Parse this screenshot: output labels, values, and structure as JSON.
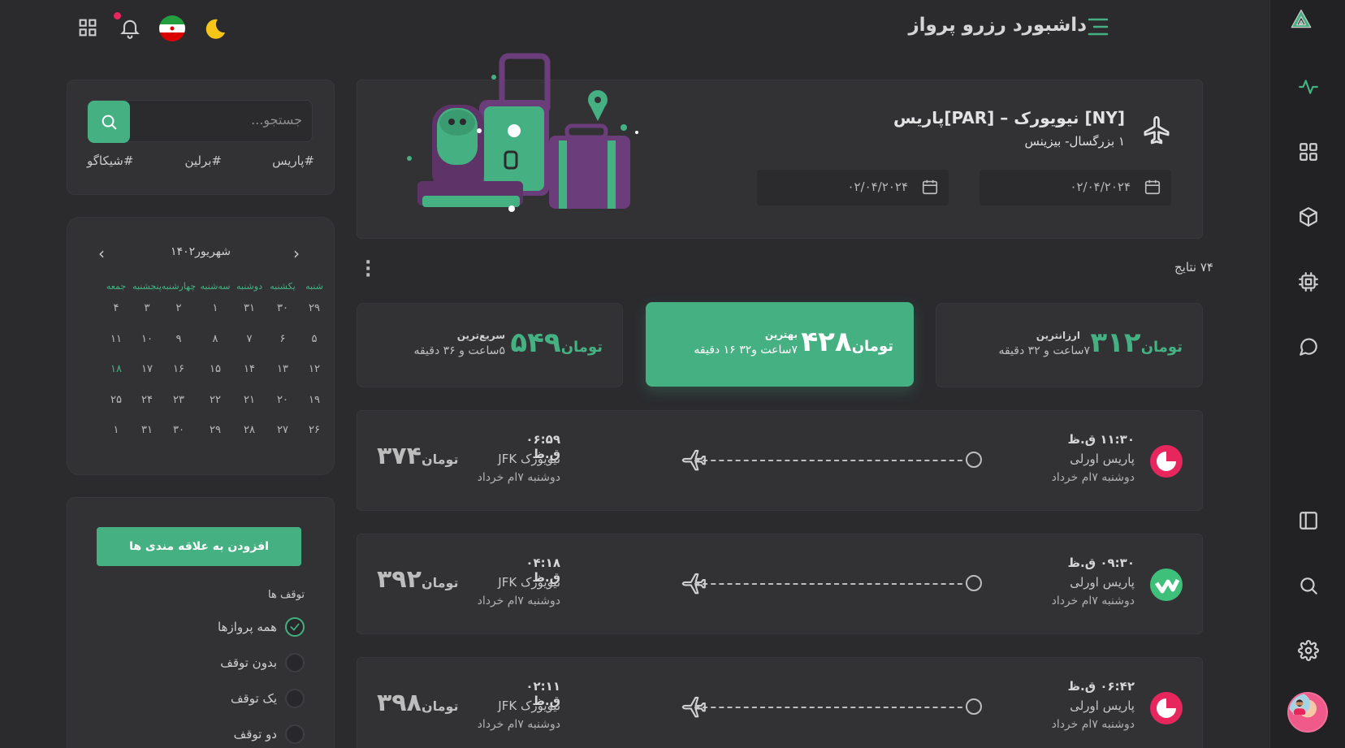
{
  "header": {
    "title": "داشبورد رزرو پرواز"
  },
  "colors": {
    "accent": "#45b183",
    "background": "#2b2b2e",
    "panel": "#323235"
  },
  "icons": {
    "rail": [
      "activity-icon",
      "grid-icon",
      "cube-icon",
      "chip-icon",
      "chat-icon",
      "sidebar-icon",
      "search-icon",
      "gear-icon"
    ],
    "top": [
      "apps-grid-icon",
      "bell-icon",
      "iran-flag-icon",
      "moon-icon"
    ]
  },
  "search": {
    "placeholder": "جستجو...",
    "tags": [
      "#پاریس",
      "#برلین",
      "#شیکاگو"
    ]
  },
  "calendar": {
    "month_label": "شهریور۱۴۰۲",
    "weekdays": [
      "شنبه",
      "یکشنبه",
      "دوشنبه",
      "سه‌شنبه",
      "چهارشنبه",
      "پنجشنبه",
      "جمعه"
    ],
    "weeks": [
      [
        "۲۹",
        "۳۰",
        "۳۱",
        "۱",
        "۲",
        "۳",
        "۴"
      ],
      [
        "۵",
        "۶",
        "۷",
        "۸",
        "۹",
        "۱۰",
        "۱۱"
      ],
      [
        "۱۲",
        "۱۳",
        "۱۴",
        "۱۵",
        "۱۶",
        "۱۷",
        "۱۸"
      ],
      [
        "۱۹",
        "۲۰",
        "۲۱",
        "۲۲",
        "۲۳",
        "۲۴",
        "۲۵"
      ],
      [
        "۲۶",
        "۲۷",
        "۲۸",
        "۲۹",
        "۳۰",
        "۳۱",
        "۱"
      ]
    ],
    "selected": "۱۸"
  },
  "filters": {
    "add_favorite_label": "افزودن به علاقه مندی ها",
    "stops_title": "توقف ها",
    "stops": [
      {
        "label": "همه پروازها",
        "checked": true
      },
      {
        "label": "بدون توقف",
        "checked": false
      },
      {
        "label": "یک توقف",
        "checked": false
      },
      {
        "label": "دو توقف",
        "checked": false
      }
    ]
  },
  "hero": {
    "route": "پاریس[PAR] – نیویورک [NY]",
    "passengers": "۱ بزرگسال- بیزینس",
    "depart_date": "۰۲/۰۴/۲۰۲۴",
    "return_date": "۰۲/۰۴/۲۰۲۴"
  },
  "results": {
    "count_label": "۷۴ نتایج",
    "summary": [
      {
        "label": "ارزانترین",
        "currency": "تومان",
        "price": "۳۱۲",
        "duration": "۷ساعت و ۳۲ دقیقه"
      },
      {
        "label": "بهترین",
        "currency": "تومان",
        "price": "۴۲۸",
        "duration": "۷ساعت و۳۲ ۱۶ دقیقه"
      },
      {
        "label": "سریع‌ترین",
        "currency": "تومان",
        "price": "۵۴۹",
        "duration": "۵ساعت و ۳۶ دقیقه"
      }
    ],
    "flights": [
      {
        "airline_color": "#e8265e",
        "dep_time": "۱۱:۳۰ ق.ظ",
        "dep_city": "پاریس اورلی",
        "dep_date": "دوشنبه ۷ام خرداد",
        "arr_time": "۰۶:۵۹ ق.ظ",
        "arr_city": "نیویورک JFK",
        "arr_date": "دوشنبه ۷ام خرداد",
        "currency": "تومان",
        "price": "۳۷۴"
      },
      {
        "airline_color": "#3fc07a",
        "dep_time": "۰۹:۳۰ ق.ظ",
        "dep_city": "پاریس اورلی",
        "dep_date": "دوشنبه ۷ام خرداد",
        "arr_time": "۰۴:۱۸ ق.ظ",
        "arr_city": "نیویورک JFK",
        "arr_date": "دوشنبه ۷ام خرداد",
        "currency": "تومان",
        "price": "۳۹۲"
      },
      {
        "airline_color": "#e8265e",
        "dep_time": "۰۶:۴۲ ق.ظ",
        "dep_city": "پاریس اورلی",
        "dep_date": "دوشنبه ۷ام خرداد",
        "arr_time": "۰۲:۱۱ ق.ظ",
        "arr_city": "نیویورک JFK",
        "arr_date": "دوشنبه ۷ام خرداد",
        "currency": "تومان",
        "price": "۳۹۸"
      }
    ]
  }
}
